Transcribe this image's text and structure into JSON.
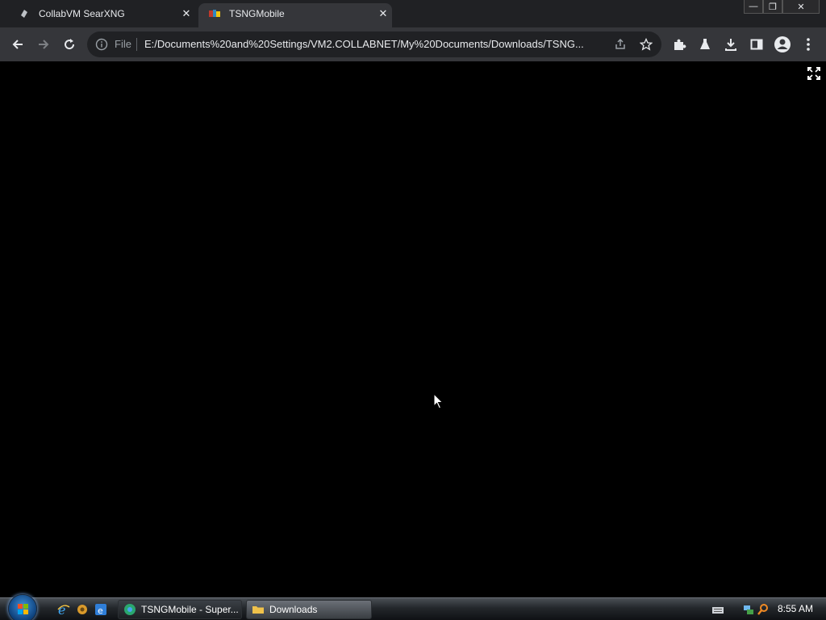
{
  "tabs": [
    {
      "title": "CollabVM SearXNG",
      "active": false
    },
    {
      "title": "TSNGMobile",
      "active": true
    }
  ],
  "toolbar": {
    "omnibox": {
      "scheme_label": "File",
      "url": "E:/Documents%20and%20Settings/VM2.COLLABNET/My%20Documents/Downloads/TSNG..."
    }
  },
  "taskbar": {
    "tasks": [
      {
        "label": "TSNGMobile - Super...",
        "icon": "chrome-icon",
        "active": true
      },
      {
        "label": "Downloads",
        "icon": "folder-icon",
        "active": false
      }
    ],
    "quick_launch": [
      "ie-icon",
      "media-icon",
      "ie-alt-icon"
    ],
    "tray": [
      "keyboard-icon",
      "network-icon",
      "search-icon"
    ],
    "clock": "8:55 AM"
  },
  "colors": {
    "titlebar": "#202124",
    "toolbar": "#35363a",
    "omnibox": "#202124",
    "content": "#000000"
  }
}
